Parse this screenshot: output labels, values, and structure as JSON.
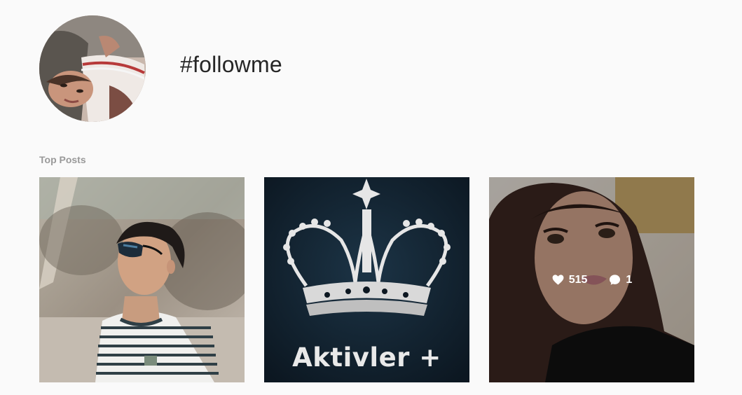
{
  "header": {
    "hashtag": "#followme",
    "avatar_icon": "profile-photo"
  },
  "top_posts": {
    "label": "Top Posts",
    "posts": [
      {
        "caption": "",
        "likes": "",
        "comments": ""
      },
      {
        "caption": "Aktivler +",
        "likes": "",
        "comments": ""
      },
      {
        "caption": "",
        "likes": "515",
        "comments": "1"
      }
    ]
  },
  "icons": {
    "likes": "heart-icon",
    "comments": "comment-icon"
  }
}
